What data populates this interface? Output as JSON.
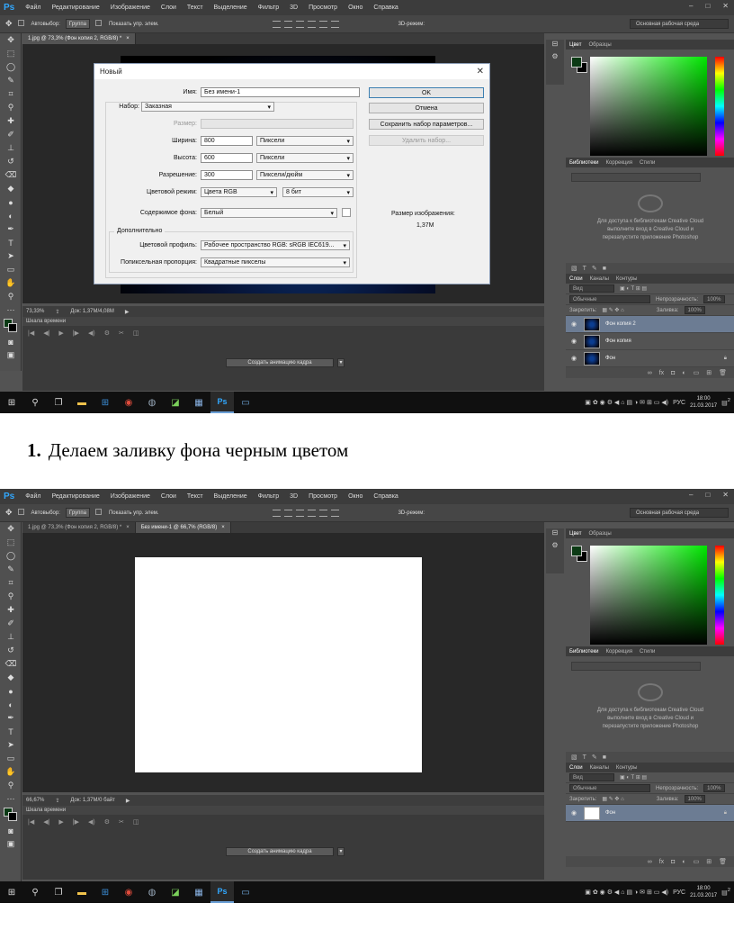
{
  "menu": [
    "Файл",
    "Редактирование",
    "Изображение",
    "Слои",
    "Текст",
    "Выделение",
    "Фильтр",
    "3D",
    "Просмотр",
    "Окно",
    "Справка"
  ],
  "ps_logo": "Ps",
  "options": {
    "autoselect": "Автовыбор:",
    "group": "Группа",
    "show_controls": "Показать упр. элем.",
    "mode3d": "3D-режим:",
    "workspace": "Основная рабочая среда"
  },
  "shot1": {
    "tabs": [
      {
        "label": "1.jpg @ 73,3% (Фон копия 2, RGB/8) *"
      }
    ],
    "status_zoom": "73,33%",
    "status_doc": "Док: 1,37M/4,08M"
  },
  "shot2": {
    "tabs": [
      {
        "label": "1.jpg @ 73,3% (Фон копия 2, RGB/8) *"
      },
      {
        "label": "Без имени-1 @ 66,7% (RGB/8)"
      }
    ],
    "status_zoom": "66,67%",
    "status_doc": "Док: 1,37M/0 байт"
  },
  "timeline": {
    "title": "Шкала времени",
    "create_button": "Создать анимацию кадра"
  },
  "panels": {
    "color_tabs": [
      "Цвет",
      "Образцы"
    ],
    "library_tabs": [
      "Библиотеки",
      "Коррекция",
      "Стили"
    ],
    "library_message": "Для доступа к библиотекам Creative Cloud выполните вход в Creative Cloud и перезапустите приложение Photoshop",
    "layers_tabs_1": [
      "Слои",
      "Каналы",
      "Контуры"
    ],
    "layers_tabs_2": [
      "Слои",
      "Каналы",
      "Контуры"
    ],
    "kind": "Вид",
    "blend": "Обычные",
    "opacity_label": "Непрозрачность:",
    "opacity_value": "100%",
    "lock_label": "Закрепить:",
    "fill_label": "Заливка:",
    "fill_value": "100%",
    "layers_1": [
      "Фон копия 2",
      "Фон копия",
      "Фон"
    ],
    "layers_2": [
      "Фон"
    ]
  },
  "taskbar": {
    "lang": "РУС",
    "time": "18:00",
    "date": "21.03.2017",
    "notif": "2"
  },
  "dialog": {
    "title": "Новый",
    "name_label": "Имя:",
    "name_value": "Без имени-1",
    "preset_label": "Набор:",
    "preset_value": "Заказная",
    "size_label": "Размер:",
    "width_label": "Ширина:",
    "width_value": "800",
    "width_unit": "Пиксели",
    "height_label": "Высота:",
    "height_value": "600",
    "height_unit": "Пиксели",
    "res_label": "Разрешение:",
    "res_value": "300",
    "res_unit": "Пиксели/дюйм",
    "mode_label": "Цветовой режим:",
    "mode_value": "Цвета RGB",
    "bits_value": "8 бит",
    "bg_label": "Содержимое фона:",
    "bg_value": "Белый",
    "advanced": "Дополнительно",
    "profile_label": "Цветовой профиль:",
    "profile_value": "Рабочее пространство RGB: sRGB IEC619...",
    "aspect_label": "Попиксельная пропорция:",
    "aspect_value": "Квадратные пикселы",
    "ok": "OK",
    "cancel": "Отмена",
    "save_preset": "Сохранить набор параметров...",
    "delete_preset": "Удалить набор...",
    "image_size_label": "Размер изображения:",
    "image_size_value": "1,37M"
  },
  "caption": {
    "number": "1.",
    "text": "Делаем заливку фона черным цветом"
  }
}
